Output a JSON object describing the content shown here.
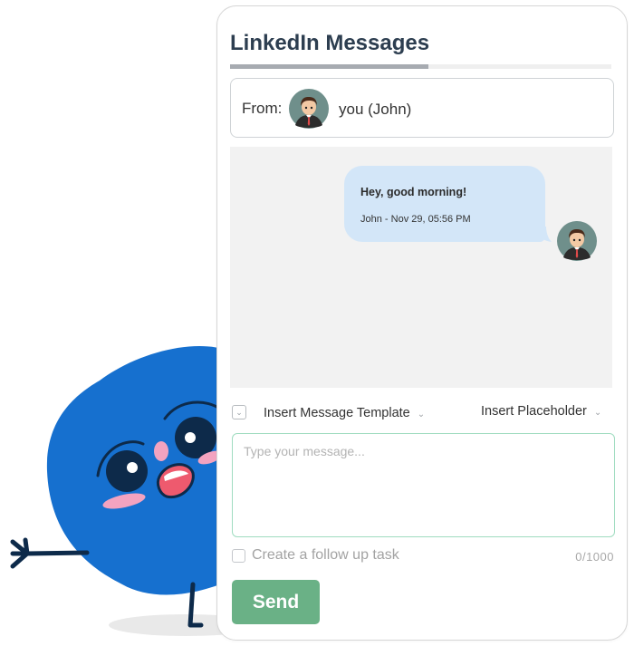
{
  "header": {
    "title": "LinkedIn Messages",
    "progress": 0.52
  },
  "from": {
    "label": "From:",
    "name": "you (John)",
    "avatar_icon": "person-avatar-icon"
  },
  "chat": {
    "messages": [
      {
        "text": "Hey, good morning!",
        "meta": "John - Nov 29, 05:56 PM",
        "bubble_color": "#d3e6f8"
      }
    ]
  },
  "toolbar": {
    "template_label": "Insert Message Template",
    "placeholder_label": "Insert Placeholder",
    "dropdown_icon": "chevron-down-icon"
  },
  "composer": {
    "placeholder": "Type your message...",
    "char_count": "0/1000"
  },
  "followup": {
    "label": "Create a follow up task"
  },
  "send": {
    "label": "Send",
    "color": "#6ab186"
  },
  "colors": {
    "title": "#2d3e50",
    "mascot": "#1670cf",
    "chat_bg": "#f2f2f2"
  }
}
